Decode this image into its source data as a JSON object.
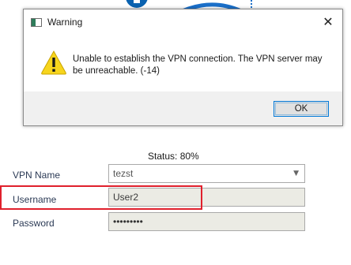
{
  "dialog": {
    "title": "Warning",
    "close_glyph": "✕",
    "icon": "warning-icon",
    "message": "Unable to establish the VPN connection. The VPN server may be unreachable. (-14)",
    "ok_label": "OK"
  },
  "form": {
    "status": "Status: 80%",
    "vpn_name_label": "VPN Name",
    "vpn_name_value": "tezst",
    "username_label": "Username",
    "username_value": "User2",
    "password_label": "Password",
    "password_masked": "•••••••••"
  },
  "colors": {
    "highlight": "#e0202c",
    "accent": "#0078d7",
    "label_text": "#2b3a55"
  }
}
